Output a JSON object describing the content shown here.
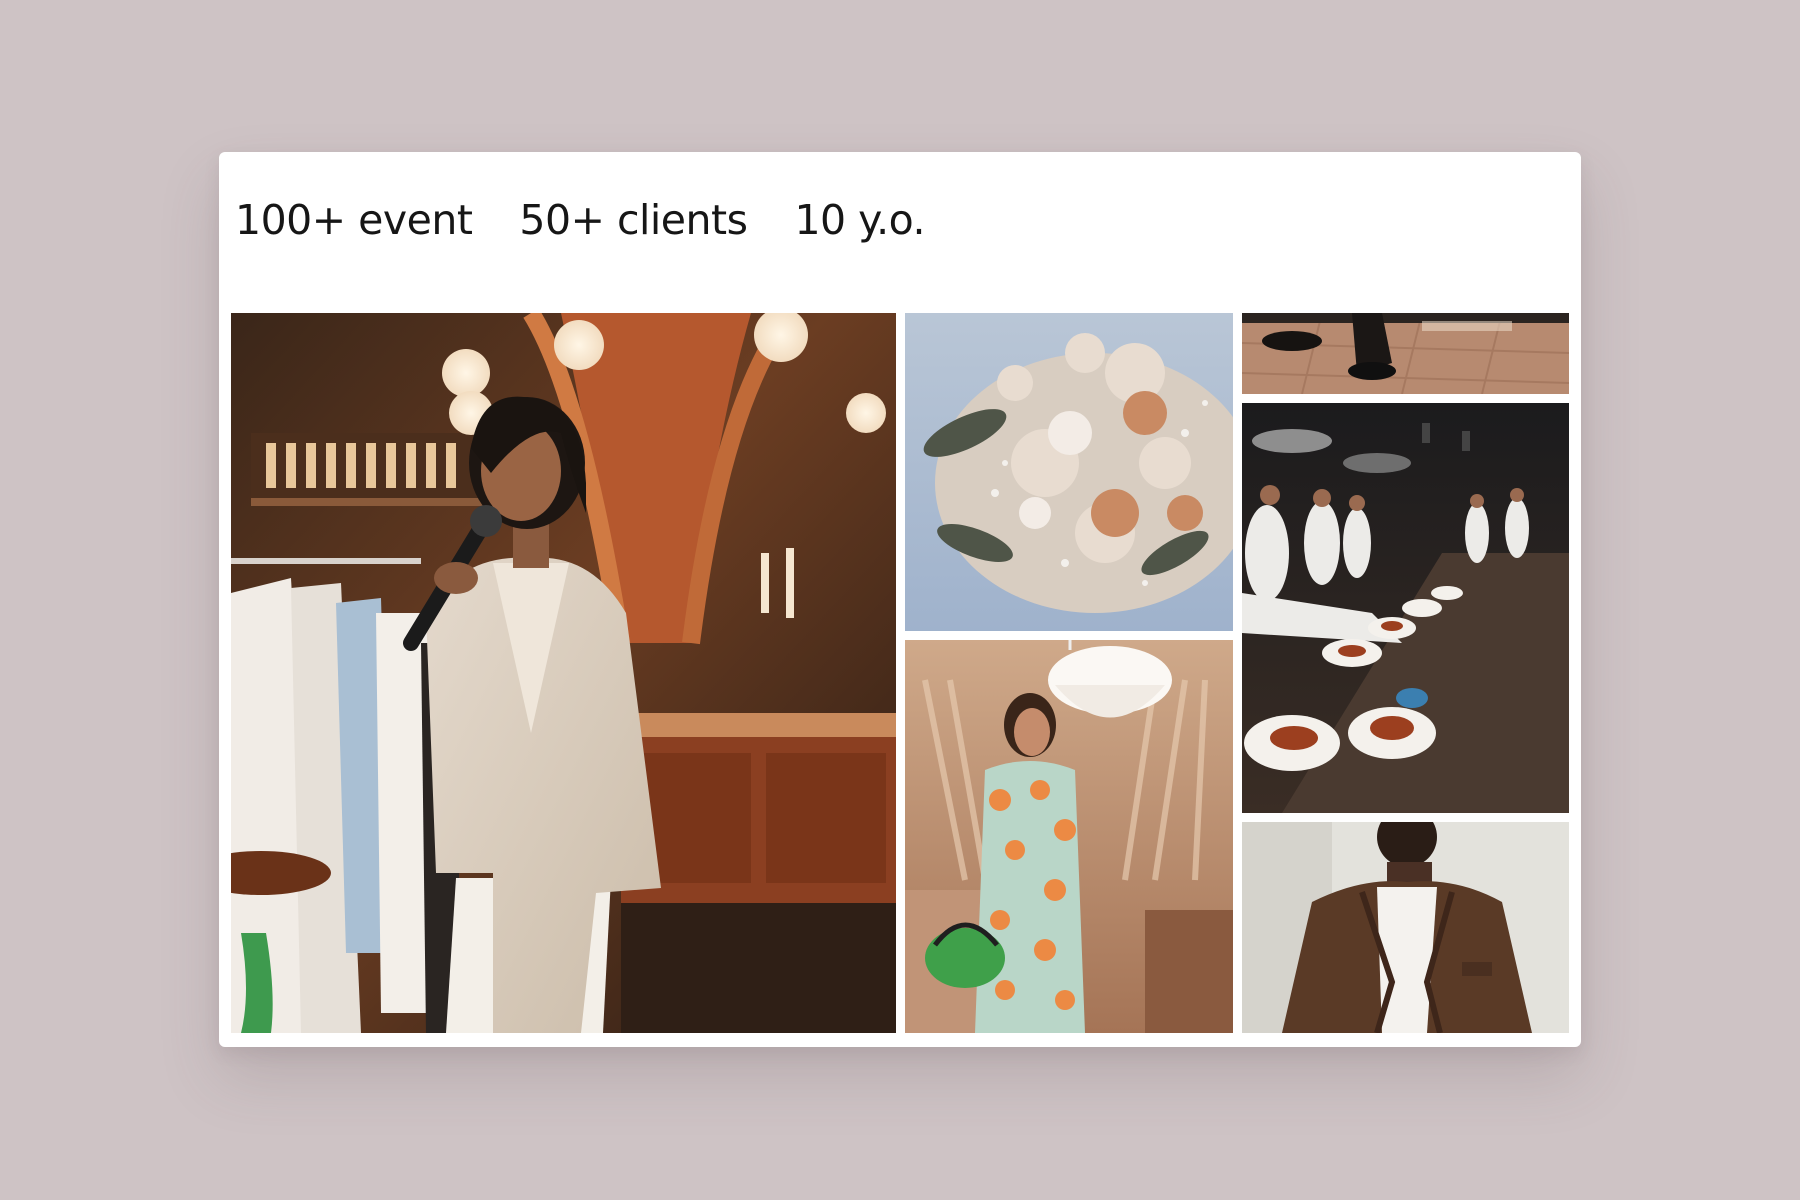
{
  "stats": [
    {
      "label": "100+ event"
    },
    {
      "label": "50+ clients"
    },
    {
      "label": "10 y.o."
    }
  ],
  "colors": {
    "background": "#cec3c5",
    "card": "#ffffff",
    "text": "#161616"
  }
}
